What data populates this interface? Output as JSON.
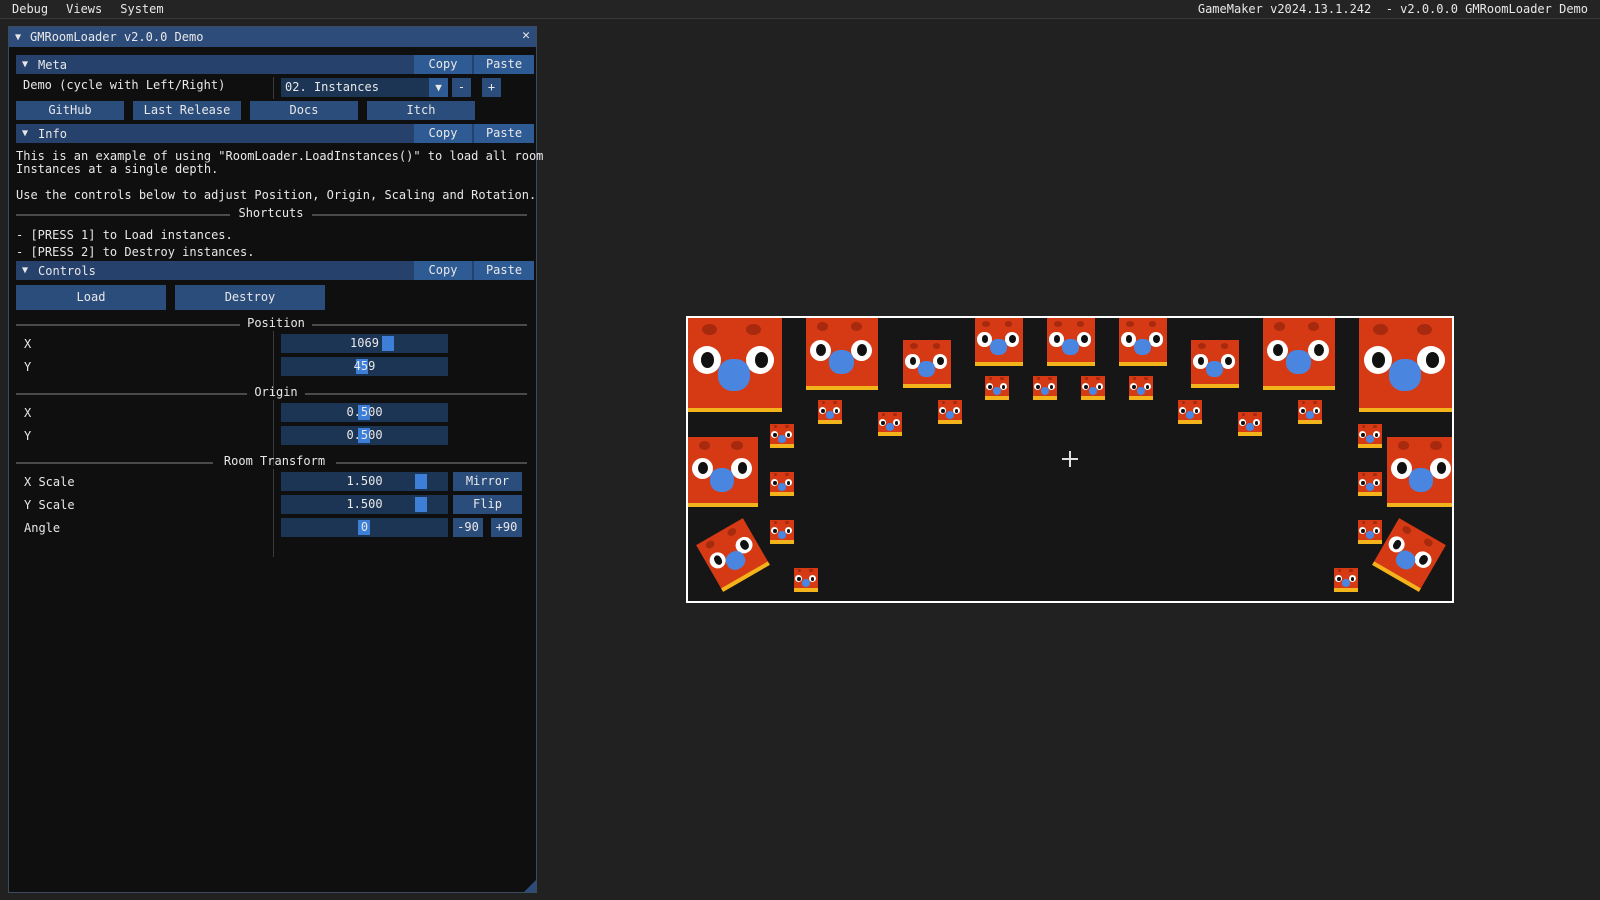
{
  "menubar": {
    "items": [
      "Debug",
      "Views",
      "System"
    ],
    "right_text": "GameMaker v2024.13.1.242  - v2.0.0.0 GMRoomLoader Demo"
  },
  "window": {
    "title": "GMRoomLoader v2.0.0 Demo",
    "collapse_icon": "triangle-down-icon",
    "close_icon": "close-icon"
  },
  "meta": {
    "header": "Meta",
    "copy": "Copy",
    "paste": "Paste",
    "demo_label": "Demo (cycle with Left/Right)",
    "demo_value": "02. Instances",
    "minus": "-",
    "plus": "+",
    "links": [
      "GitHub",
      "Last Release",
      "Docs",
      "Itch"
    ]
  },
  "info": {
    "header": "Info",
    "copy": "Copy",
    "paste": "Paste",
    "line1": "This is an example of using \"RoomLoader.LoadInstances()\" to load all room",
    "line2": "Instances at a single depth.",
    "line3": "Use the controls below to adjust Position, Origin, Scaling and Rotation.",
    "shortcuts_title": "Shortcuts",
    "shortcut1": "- [PRESS 1] to Load instances.",
    "shortcut2": "- [PRESS 2] to Destroy instances."
  },
  "controls": {
    "header": "Controls",
    "copy": "Copy",
    "paste": "Paste",
    "load": "Load",
    "destroy": "Destroy",
    "position_title": "Position",
    "pos_x_label": "X",
    "pos_x": "1069",
    "pos_y_label": "Y",
    "pos_y": "459",
    "origin_title": "Origin",
    "origin_x_label": "X",
    "origin_x": "0.500",
    "origin_y_label": "Y",
    "origin_y": "0.500",
    "transform_title": "Room Transform",
    "xscale_label": "X Scale",
    "xscale": "1.500",
    "mirror": "Mirror",
    "yscale_label": "Y Scale",
    "yscale": "1.500",
    "flip": "Flip",
    "angle_label": "Angle",
    "angle": "0",
    "minus90": "-90",
    "plus90": "+90"
  },
  "colors": {
    "window_title": "#2d4c79",
    "section_header": "#26416b",
    "button": "#2b4d7c",
    "slider_grab": "#3d7fd6",
    "room_border": "#ffffff",
    "creature_red": "#d53a14",
    "creature_yellow": "#f2b41a",
    "creature_nose": "#4a86e0"
  }
}
